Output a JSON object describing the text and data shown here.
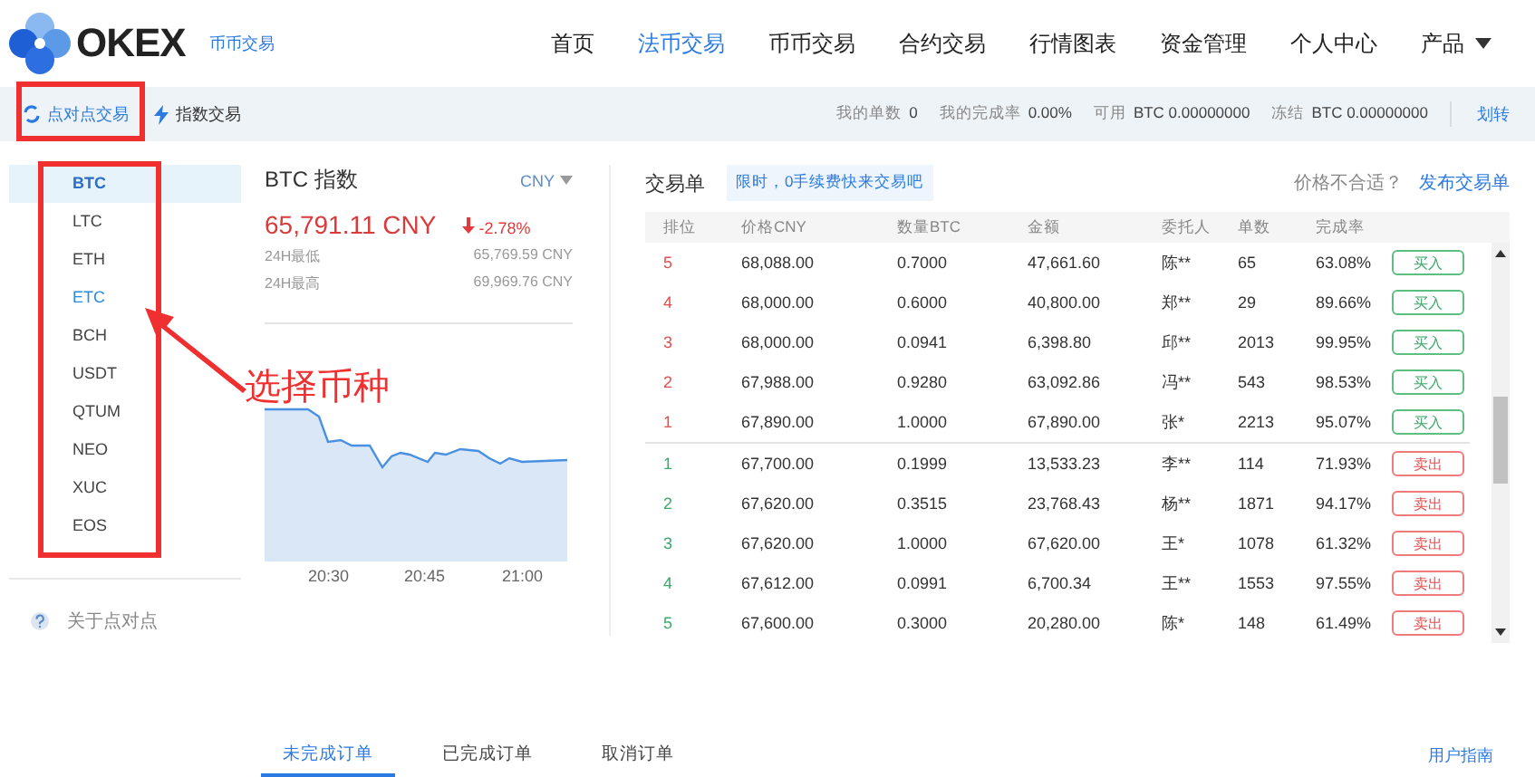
{
  "header": {
    "logo": "OKEX",
    "subtitle": "币币交易",
    "nav": [
      {
        "label": "首页",
        "selected": false
      },
      {
        "label": "法币交易",
        "selected": true
      },
      {
        "label": "币币交易",
        "selected": false
      },
      {
        "label": "合约交易",
        "selected": false
      },
      {
        "label": "行情图表",
        "selected": false
      },
      {
        "label": "资金管理",
        "selected": false
      },
      {
        "label": "个人中心",
        "selected": false
      },
      {
        "label": "产品",
        "selected": false,
        "kind": "dropdown"
      }
    ]
  },
  "subbar": {
    "tabs": [
      {
        "label": "点对点交易",
        "selected": true,
        "kind": "swap"
      },
      {
        "label": "指数交易",
        "selected": false,
        "kind": "bolt"
      }
    ],
    "stats": [
      {
        "label": "我的单数",
        "value": "0"
      },
      {
        "label": "我的完成率",
        "value": "0.00%"
      },
      {
        "label": "可用",
        "value": "BTC 0.00000000"
      },
      {
        "label": "冻结",
        "value": "BTC 0.00000000"
      }
    ],
    "transfer": "划转"
  },
  "coins": [
    {
      "label": "BTC",
      "selected": true,
      "hovered": false
    },
    {
      "label": "LTC",
      "selected": false,
      "hovered": false
    },
    {
      "label": "ETH",
      "selected": false,
      "hovered": false
    },
    {
      "label": "ETC",
      "selected": false,
      "hovered": true
    },
    {
      "label": "BCH",
      "selected": false,
      "hovered": false
    },
    {
      "label": "USDT",
      "selected": false,
      "hovered": false
    },
    {
      "label": "QTUM",
      "selected": false,
      "hovered": false
    },
    {
      "label": "NEO",
      "selected": false,
      "hovered": false
    },
    {
      "label": "XUC",
      "selected": false,
      "hovered": false
    },
    {
      "label": "EOS",
      "selected": false,
      "hovered": false
    }
  ],
  "about": "关于点对点",
  "index": {
    "title": "BTC 指数",
    "currency": "CNY",
    "price": "65,791.11 CNY",
    "change": "-2.78%",
    "stats": [
      {
        "label": "24H最低",
        "value": "65,769.59 CNY"
      },
      {
        "label": "24H最高",
        "value": "69,969.76 CNY"
      }
    ],
    "chart_times": [
      "20:30",
      "20:45",
      "21:00"
    ]
  },
  "orders": {
    "title": "交易单",
    "promo": "限时，0手续费快来交易吧",
    "question": "价格不合适？",
    "post_link": "发布交易单",
    "columns": [
      "排位",
      "价格CNY",
      "数量BTC",
      "金额",
      "委托人",
      "单数",
      "完成率"
    ],
    "rows": [
      {
        "kind": "buy",
        "cells": [
          "5",
          "68,088.00",
          "0.7000",
          "47,661.60",
          "陈**",
          "65",
          "63.08%"
        ],
        "action": "买入"
      },
      {
        "kind": "buy",
        "cells": [
          "4",
          "68,000.00",
          "0.6000",
          "40,800.00",
          "郑**",
          "29",
          "89.66%"
        ],
        "action": "买入"
      },
      {
        "kind": "buy",
        "cells": [
          "3",
          "68,000.00",
          "0.0941",
          "6,398.80",
          "邱**",
          "2013",
          "99.95%"
        ],
        "action": "买入"
      },
      {
        "kind": "buy",
        "cells": [
          "2",
          "67,988.00",
          "0.9280",
          "63,092.86",
          "冯**",
          "543",
          "98.53%"
        ],
        "action": "买入"
      },
      {
        "kind": "buy",
        "cells": [
          "1",
          "67,890.00",
          "1.0000",
          "67,890.00",
          "张*",
          "2213",
          "95.07%"
        ],
        "action": "买入"
      },
      {
        "kind": "sell",
        "cells": [
          "1",
          "67,700.00",
          "0.1999",
          "13,533.23",
          "李**",
          "114",
          "71.93%"
        ],
        "action": "卖出"
      },
      {
        "kind": "sell",
        "cells": [
          "2",
          "67,620.00",
          "0.3515",
          "23,768.43",
          "杨**",
          "1871",
          "94.17%"
        ],
        "action": "卖出"
      },
      {
        "kind": "sell",
        "cells": [
          "3",
          "67,620.00",
          "1.0000",
          "67,620.00",
          "王*",
          "1078",
          "61.32%"
        ],
        "action": "卖出"
      },
      {
        "kind": "sell",
        "cells": [
          "4",
          "67,612.00",
          "0.0991",
          "6,700.34",
          "王**",
          "1553",
          "97.55%"
        ],
        "action": "卖出"
      },
      {
        "kind": "sell",
        "cells": [
          "5",
          "67,600.00",
          "0.3000",
          "20,280.00",
          "陈*",
          "148",
          "61.49%"
        ],
        "action": "卖出"
      }
    ]
  },
  "bottom_tabs": [
    {
      "label": "未完成订单",
      "selected": true
    },
    {
      "label": "已完成订单",
      "selected": false
    },
    {
      "label": "取消订单",
      "selected": false
    }
  ],
  "guide_link": "用户指南",
  "annotation": "选择币种"
}
